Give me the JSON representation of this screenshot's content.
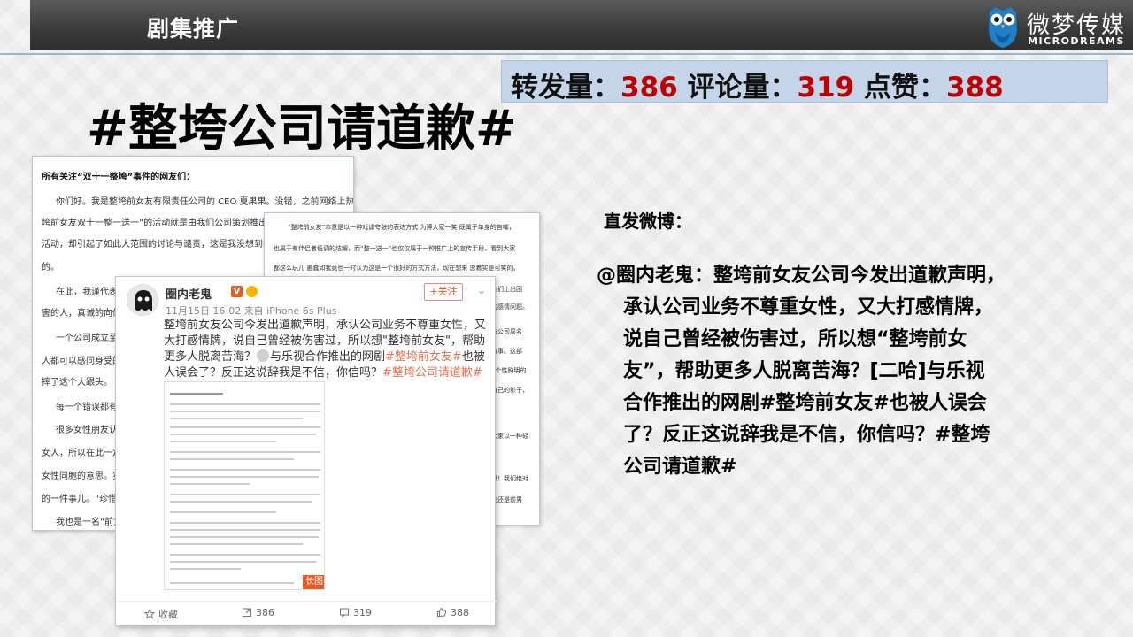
{
  "header": {
    "section_title": "剧集推广",
    "logo_cn": "微梦传媒",
    "logo_en": "MICRODREAMS"
  },
  "stats": {
    "repost_label": "转发量：",
    "repost_value": "386",
    "comment_label": "评论量：",
    "comment_value": "319",
    "like_label": "点赞：",
    "like_value": "388"
  },
  "hashtag_title": "#整垮公司请道歉#",
  "paper1": {
    "lines": [
      "所有关注“双十一整垮”事件的网友们：",
      "你们好。我是整垮前女友有限责任公司的 CEO 夏果果。没错，之前网络上热议的“整",
      "垮前女友双十一整一送一”的活动就是由我们公司策划推出的。本是",
      "活动，却引起了如此大范围的讨论与谴责，这是我没想到的，所造成",
      "的。",
      "在此，我谨代表整",
      "害的人，真诚的向你们",
      "一个公司成立至今",
      "人都可以感同身受的，",
      "摔了这个大跟头。",
      "每一个错误都有应",
      "很多女性朋友认为",
      "女人，所以在此一定要",
      "女性同胞的意思。实际",
      "的一件事儿。“珍惜所有",
      "我也是一名“前女"
    ]
  },
  "paper2": {
    "lines": [
      "“整垮前女友”本意是以一种戏谑夸张的表达方式 为博大家一笑 既属于单身的自嘲，",
      "也属于有伴侣者低调的炫耀，而“整一送一”也仅仅属于一种推广上的宣传手段，看到大家",
      "都这么玩儿 愚蠢如我竟也一时认为这是一个很好的方式方法，现在想来 忠着实是可笑的。",
      "他们止出困",
      "的感情问题。",
      "与公司周名",
      "敏事。这部",
      "2个性鲜明的",
      "自己的影子，",
      "大家以一种轻",
      "康！我们绝对",
      "友还是前男"
    ]
  },
  "weibo": {
    "user": "圈内老鬼",
    "v_badge": "V",
    "meta": "11月15日 16:02 来自 iPhone 6s Plus",
    "follow": "+关注",
    "text_part1": "整垮前女友公司今发出道歉声明，承认公司业务不尊重女性，又大打感情牌，说自己曾经被伤害过，所以想\"整垮前女友\"，帮助更多人脱离苦海？",
    "text_part2": "与乐视合作推出的网剧",
    "text_hl1": "#整垮前女友#",
    "text_part3": "也被人误会了？反正这说辞我是不信，你信吗？",
    "text_hl2": "#整垮公司请道歉#",
    "long_image_label": "长图",
    "actions": {
      "favorite": "收藏",
      "repost": "386",
      "comment": "319",
      "like": "388"
    }
  },
  "right": {
    "label": "直发微博：",
    "lines": [
      "@圈内老鬼：整垮前女友公司今发出道歉声明，",
      "承认公司业务不尊重女性，又大打感情牌，",
      "说自己曾经被伤害过，所以想“整垮前女",
      "友”，帮助更多人脱离苦海？[二哈]与乐视",
      "合作推出的网剧#整垮前女友#也被人误会",
      "了？反正这说辞我是不信，你信吗？#整垮",
      "公司请道歉#"
    ]
  },
  "colors": {
    "accent_red": "#c00000",
    "stats_bg": "#c4d5ea",
    "weibo_highlight": "#eb7350"
  }
}
